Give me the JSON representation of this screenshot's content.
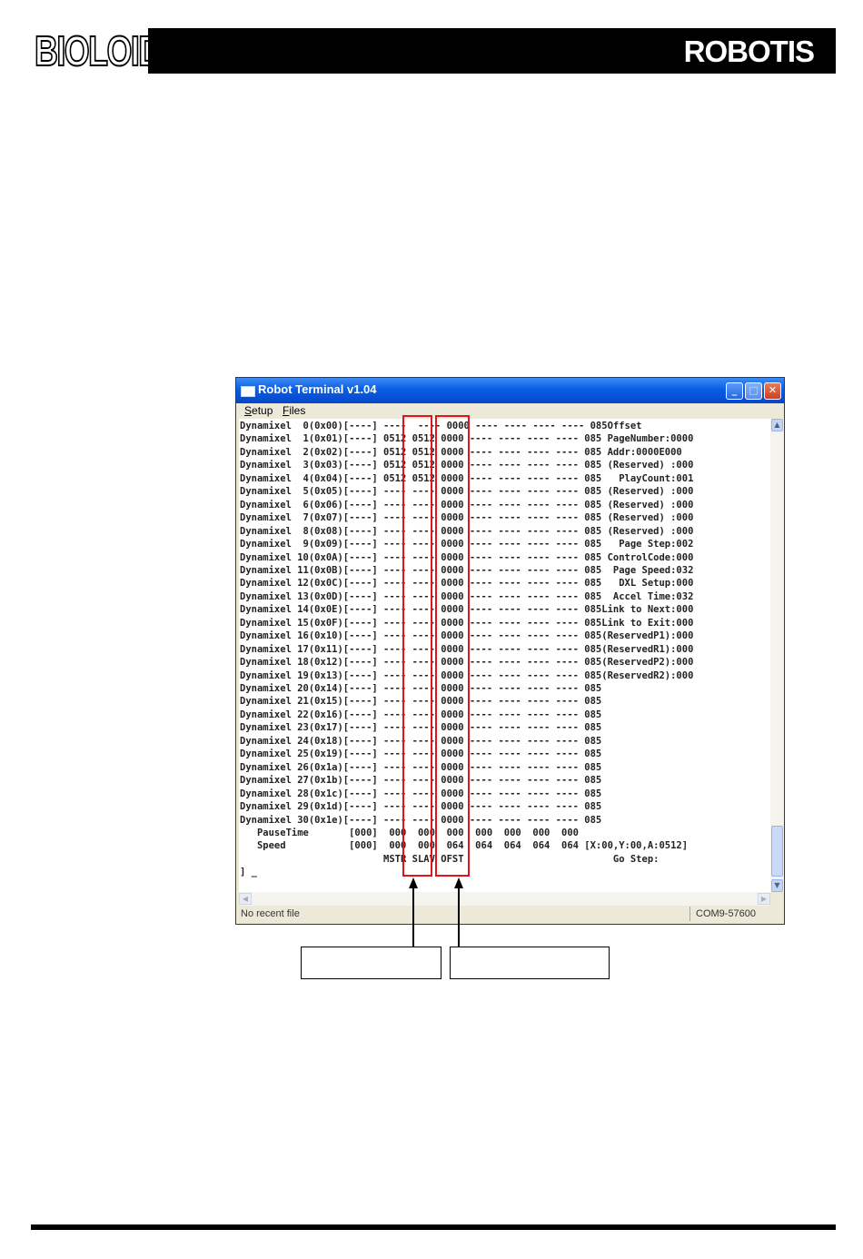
{
  "header": {
    "left_logo": "BIOLOID",
    "right_logo": "ROBOTIS"
  },
  "window": {
    "title": "Robot Terminal v1.04",
    "menu": [
      {
        "access_key": "S",
        "rest": "etup"
      },
      {
        "access_key": "F",
        "rest": "iles"
      }
    ],
    "terminal_lines": [
      "Dynamixel  0(0x00)[----] ----  ---- 0000 ---- ---- ---- ---- 085Offset",
      "Dynamixel  1(0x01)[----] 0512 0512 0000 ---- ---- ---- ---- 085 PageNumber:0000",
      "Dynamixel  2(0x02)[----] 0512 0512 0000 ---- ---- ---- ---- 085 Addr:0000E000",
      "Dynamixel  3(0x03)[----] 0512 0512 0000 ---- ---- ---- ---- 085 (Reserved) :000",
      "Dynamixel  4(0x04)[----] 0512 0512 0000 ---- ---- ---- ---- 085   PlayCount:001",
      "Dynamixel  5(0x05)[----] ---- ---- 0000 ---- ---- ---- ---- 085 (Reserved) :000",
      "Dynamixel  6(0x06)[----] ---- ---- 0000 ---- ---- ---- ---- 085 (Reserved) :000",
      "Dynamixel  7(0x07)[----] ---- ---- 0000 ---- ---- ---- ---- 085 (Reserved) :000",
      "Dynamixel  8(0x08)[----] ---- ---- 0000 ---- ---- ---- ---- 085 (Reserved) :000",
      "Dynamixel  9(0x09)[----] ---- ---- 0000 ---- ---- ---- ---- 085   Page Step:002",
      "Dynamixel 10(0x0A)[----] ---- ---- 0000 ---- ---- ---- ---- 085 ControlCode:000",
      "Dynamixel 11(0x0B)[----] ---- ---- 0000 ---- ---- ---- ---- 085  Page Speed:032",
      "Dynamixel 12(0x0C)[----] ---- ---- 0000 ---- ---- ---- ---- 085   DXL Setup:000",
      "Dynamixel 13(0x0D)[----] ---- ---- 0000 ---- ---- ---- ---- 085  Accel Time:032",
      "Dynamixel 14(0x0E)[----] ---- ---- 0000 ---- ---- ---- ---- 085Link to Next:000",
      "Dynamixel 15(0x0F)[----] ---- ---- 0000 ---- ---- ---- ---- 085Link to Exit:000",
      "Dynamixel 16(0x10)[----] ---- ---- 0000 ---- ---- ---- ---- 085(ReservedP1):000",
      "Dynamixel 17(0x11)[----] ---- ---- 0000 ---- ---- ---- ---- 085(ReservedR1):000",
      "Dynamixel 18(0x12)[----] ---- ---- 0000 ---- ---- ---- ---- 085(ReservedP2):000",
      "Dynamixel 19(0x13)[----] ---- ---- 0000 ---- ---- ---- ---- 085(ReservedR2):000",
      "Dynamixel 20(0x14)[----] ---- ---- 0000 ---- ---- ---- ---- 085",
      "Dynamixel 21(0x15)[----] ---- ---- 0000 ---- ---- ---- ---- 085",
      "Dynamixel 22(0x16)[----] ---- ---- 0000 ---- ---- ---- ---- 085",
      "Dynamixel 23(0x17)[----] ---- ---- 0000 ---- ---- ---- ---- 085",
      "Dynamixel 24(0x18)[----] ---- ---- 0000 ---- ---- ---- ---- 085",
      "Dynamixel 25(0x19)[----] ---- ---- 0000 ---- ---- ---- ---- 085",
      "Dynamixel 26(0x1a)[----] ---- ---- 0000 ---- ---- ---- ---- 085",
      "Dynamixel 27(0x1b)[----] ---- ---- 0000 ---- ---- ---- ---- 085",
      "Dynamixel 28(0x1c)[----] ---- ---- 0000 ---- ---- ---- ---- 085",
      "Dynamixel 29(0x1d)[----] ---- ---- 0000 ---- ---- ---- ---- 085",
      "Dynamixel 30(0x1e)[----] ---- ---- 0000 ---- ---- ---- ---- 085",
      "   PauseTime       [000]  000  000  000  000  000  000  000",
      "   Speed           [000]  000  000  064  064  064  064  064 [X:00,Y:00,A:0512]",
      "                         MSTR SLAV OFST                          Go Step:",
      "] _"
    ],
    "status_left": "No recent file",
    "status_right": "COM9-57600"
  }
}
